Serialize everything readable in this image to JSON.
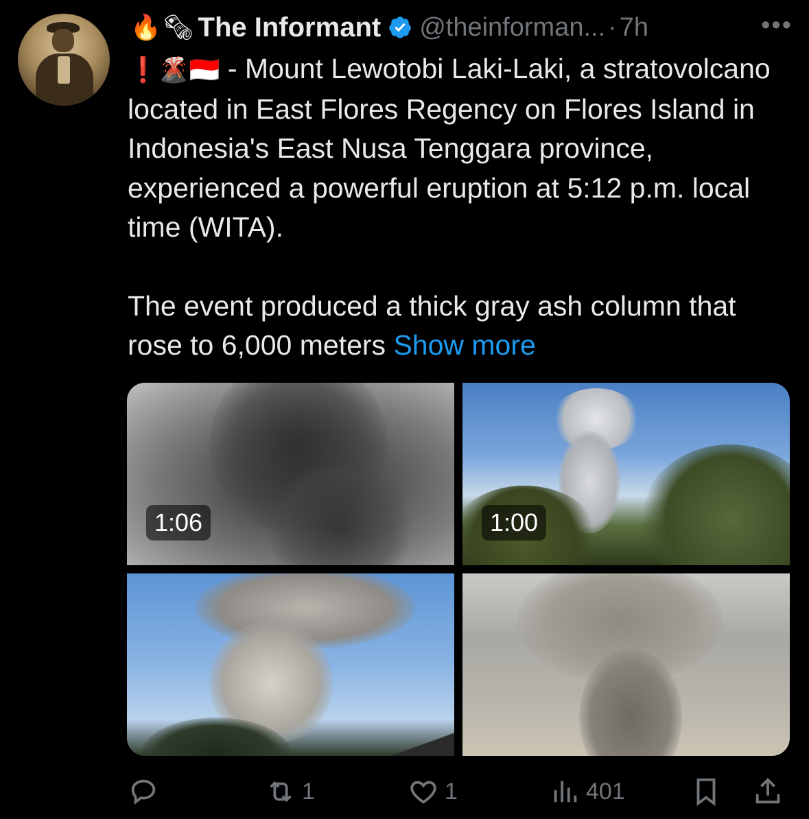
{
  "author": {
    "emojis": [
      "🔥",
      "🗞"
    ],
    "name": "The Informant",
    "handle": "@theinforman...",
    "separator": "·",
    "time": "7h",
    "more": "•••"
  },
  "tweet": {
    "line1_emojis": "❗🌋🇮🇩",
    "paragraph1": " - Mount Lewotobi Laki-Laki, a stratovolcano located in East Flores Regency on Flores Island in Indonesia's East Nusa Tenggara province, experienced a powerful eruption at 5:12 p.m. local time (WITA).",
    "paragraph2": "The event produced a thick gray ash column that rose to 6,000 meters",
    "show_more": "Show more"
  },
  "media": {
    "videos": [
      {
        "duration": "1:06"
      },
      {
        "duration": "1:00"
      }
    ]
  },
  "actions": {
    "reply_count": "",
    "retweet_count": "1",
    "like_count": "1",
    "views_count": "401"
  },
  "colors": {
    "background": "#000000",
    "text": "#e7e9ea",
    "muted": "#71767b",
    "link": "#1d9bf0",
    "verified": "#1d9bf0"
  }
}
